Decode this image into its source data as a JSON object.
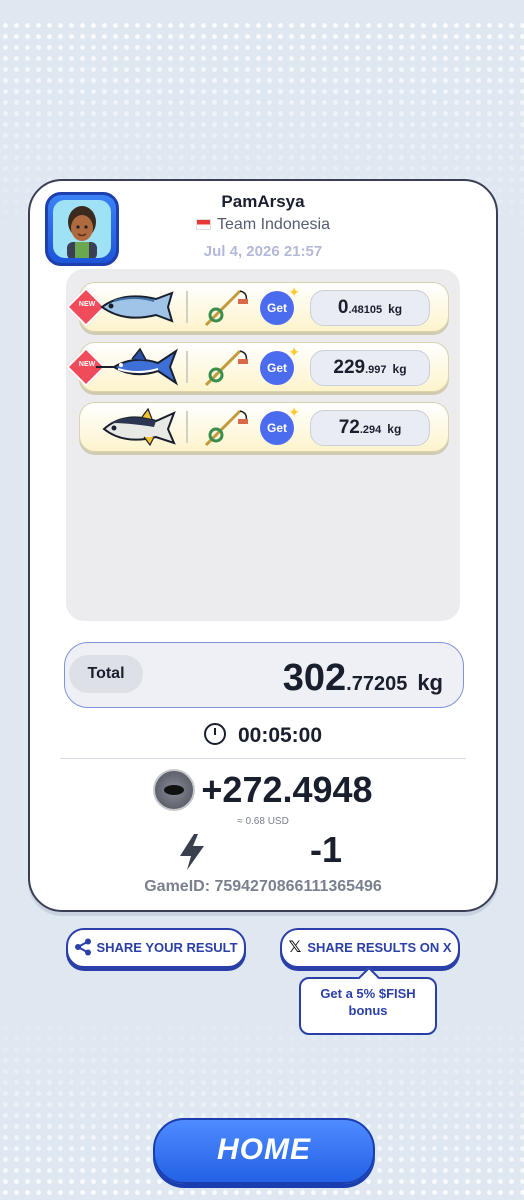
{
  "player": {
    "name": "PamArsya",
    "team": "Team Indonesia",
    "date": "Jul 4, 2026 21:57"
  },
  "catches": [
    {
      "new": true,
      "fish_icon": "bonito-fish-icon",
      "weight_main": "0",
      "weight_dec": ".48105",
      "unit": "kg"
    },
    {
      "new": true,
      "fish_icon": "marlin-fish-icon",
      "weight_main": "229",
      "weight_dec": ".997",
      "unit": "kg"
    },
    {
      "new": false,
      "fish_icon": "tuna-fish-icon",
      "weight_main": "72",
      "weight_dec": ".294",
      "unit": "kg"
    }
  ],
  "labels": {
    "new": "NEW",
    "get": "Get"
  },
  "total": {
    "label": "Total",
    "main": "302",
    "dec": ".77205",
    "unit": "kg"
  },
  "duration": "00:05:00",
  "reward": {
    "amount": "+272.4948",
    "usd": "≈ 0.68 USD",
    "energy": "-1",
    "game_id": "GameID: 7594270866111365496"
  },
  "buttons": {
    "share_result": "SHARE YOUR RESULT",
    "share_x": "SHARE RESULTS ON X",
    "bonus_tip": "Get a 5% $FISH bonus",
    "home": "HOME"
  }
}
